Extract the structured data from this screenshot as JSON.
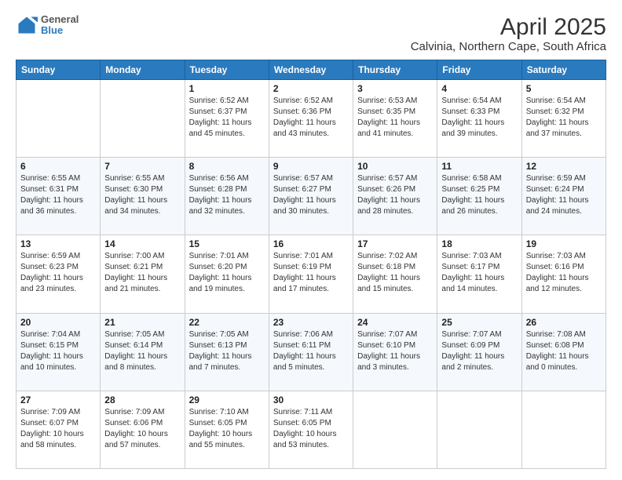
{
  "header": {
    "logo_line1": "General",
    "logo_line2": "Blue",
    "title": "April 2025",
    "subtitle": "Calvinia, Northern Cape, South Africa"
  },
  "weekdays": [
    "Sunday",
    "Monday",
    "Tuesday",
    "Wednesday",
    "Thursday",
    "Friday",
    "Saturday"
  ],
  "weeks": [
    [
      {
        "day": "",
        "info": ""
      },
      {
        "day": "",
        "info": ""
      },
      {
        "day": "1",
        "info": "Sunrise: 6:52 AM\nSunset: 6:37 PM\nDaylight: 11 hours and 45 minutes."
      },
      {
        "day": "2",
        "info": "Sunrise: 6:52 AM\nSunset: 6:36 PM\nDaylight: 11 hours and 43 minutes."
      },
      {
        "day": "3",
        "info": "Sunrise: 6:53 AM\nSunset: 6:35 PM\nDaylight: 11 hours and 41 minutes."
      },
      {
        "day": "4",
        "info": "Sunrise: 6:54 AM\nSunset: 6:33 PM\nDaylight: 11 hours and 39 minutes."
      },
      {
        "day": "5",
        "info": "Sunrise: 6:54 AM\nSunset: 6:32 PM\nDaylight: 11 hours and 37 minutes."
      }
    ],
    [
      {
        "day": "6",
        "info": "Sunrise: 6:55 AM\nSunset: 6:31 PM\nDaylight: 11 hours and 36 minutes."
      },
      {
        "day": "7",
        "info": "Sunrise: 6:55 AM\nSunset: 6:30 PM\nDaylight: 11 hours and 34 minutes."
      },
      {
        "day": "8",
        "info": "Sunrise: 6:56 AM\nSunset: 6:28 PM\nDaylight: 11 hours and 32 minutes."
      },
      {
        "day": "9",
        "info": "Sunrise: 6:57 AM\nSunset: 6:27 PM\nDaylight: 11 hours and 30 minutes."
      },
      {
        "day": "10",
        "info": "Sunrise: 6:57 AM\nSunset: 6:26 PM\nDaylight: 11 hours and 28 minutes."
      },
      {
        "day": "11",
        "info": "Sunrise: 6:58 AM\nSunset: 6:25 PM\nDaylight: 11 hours and 26 minutes."
      },
      {
        "day": "12",
        "info": "Sunrise: 6:59 AM\nSunset: 6:24 PM\nDaylight: 11 hours and 24 minutes."
      }
    ],
    [
      {
        "day": "13",
        "info": "Sunrise: 6:59 AM\nSunset: 6:23 PM\nDaylight: 11 hours and 23 minutes."
      },
      {
        "day": "14",
        "info": "Sunrise: 7:00 AM\nSunset: 6:21 PM\nDaylight: 11 hours and 21 minutes."
      },
      {
        "day": "15",
        "info": "Sunrise: 7:01 AM\nSunset: 6:20 PM\nDaylight: 11 hours and 19 minutes."
      },
      {
        "day": "16",
        "info": "Sunrise: 7:01 AM\nSunset: 6:19 PM\nDaylight: 11 hours and 17 minutes."
      },
      {
        "day": "17",
        "info": "Sunrise: 7:02 AM\nSunset: 6:18 PM\nDaylight: 11 hours and 15 minutes."
      },
      {
        "day": "18",
        "info": "Sunrise: 7:03 AM\nSunset: 6:17 PM\nDaylight: 11 hours and 14 minutes."
      },
      {
        "day": "19",
        "info": "Sunrise: 7:03 AM\nSunset: 6:16 PM\nDaylight: 11 hours and 12 minutes."
      }
    ],
    [
      {
        "day": "20",
        "info": "Sunrise: 7:04 AM\nSunset: 6:15 PM\nDaylight: 11 hours and 10 minutes."
      },
      {
        "day": "21",
        "info": "Sunrise: 7:05 AM\nSunset: 6:14 PM\nDaylight: 11 hours and 8 minutes."
      },
      {
        "day": "22",
        "info": "Sunrise: 7:05 AM\nSunset: 6:13 PM\nDaylight: 11 hours and 7 minutes."
      },
      {
        "day": "23",
        "info": "Sunrise: 7:06 AM\nSunset: 6:11 PM\nDaylight: 11 hours and 5 minutes."
      },
      {
        "day": "24",
        "info": "Sunrise: 7:07 AM\nSunset: 6:10 PM\nDaylight: 11 hours and 3 minutes."
      },
      {
        "day": "25",
        "info": "Sunrise: 7:07 AM\nSunset: 6:09 PM\nDaylight: 11 hours and 2 minutes."
      },
      {
        "day": "26",
        "info": "Sunrise: 7:08 AM\nSunset: 6:08 PM\nDaylight: 11 hours and 0 minutes."
      }
    ],
    [
      {
        "day": "27",
        "info": "Sunrise: 7:09 AM\nSunset: 6:07 PM\nDaylight: 10 hours and 58 minutes."
      },
      {
        "day": "28",
        "info": "Sunrise: 7:09 AM\nSunset: 6:06 PM\nDaylight: 10 hours and 57 minutes."
      },
      {
        "day": "29",
        "info": "Sunrise: 7:10 AM\nSunset: 6:05 PM\nDaylight: 10 hours and 55 minutes."
      },
      {
        "day": "30",
        "info": "Sunrise: 7:11 AM\nSunset: 6:05 PM\nDaylight: 10 hours and 53 minutes."
      },
      {
        "day": "",
        "info": ""
      },
      {
        "day": "",
        "info": ""
      },
      {
        "day": "",
        "info": ""
      }
    ]
  ]
}
